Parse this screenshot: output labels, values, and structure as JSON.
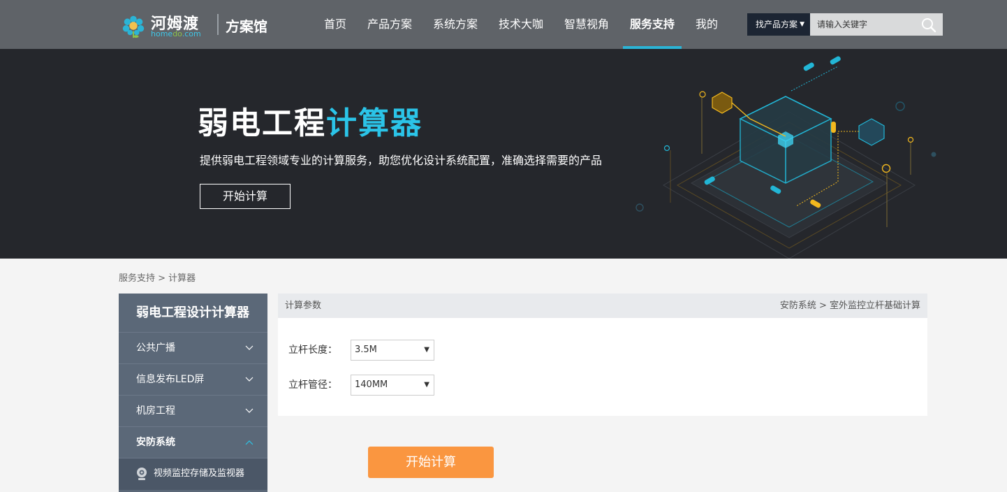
{
  "header": {
    "logo_cn": "河姆渡",
    "logo_en_a": "home",
    "logo_en_b": "do",
    "logo_en_c": ".com",
    "section_title": "方案馆",
    "nav": [
      {
        "label": "首页"
      },
      {
        "label": "产品方案"
      },
      {
        "label": "系统方案"
      },
      {
        "label": "技术大咖"
      },
      {
        "label": "智慧视角"
      },
      {
        "label": "服务支持",
        "active": true
      },
      {
        "label": "我的"
      }
    ],
    "search": {
      "category": "找产品方案",
      "placeholder": "请输入关键字"
    }
  },
  "banner": {
    "title_main": "弱电工程",
    "title_highlight": "计算器",
    "description": "提供弱电工程领域专业的计算服务，助您优化设计系统配置，准确选择需要的产品",
    "button": "开始计算"
  },
  "breadcrumb": "服务支持 > 计算器",
  "sidebar": {
    "title": "弱电工程设计计算器",
    "items": [
      {
        "label": "公共广播"
      },
      {
        "label": "信息发布LED屏"
      },
      {
        "label": "机房工程"
      },
      {
        "label": "安防系统",
        "expanded": true
      }
    ],
    "sub_items": [
      {
        "label": "视频监控存储及监视器"
      }
    ]
  },
  "panel": {
    "head_left": "计算参数",
    "head_right": "安防系统 > 室外监控立杆基础计算",
    "fields": [
      {
        "label": "立杆长度：",
        "value": "3.5M"
      },
      {
        "label": "立杆管径：",
        "value": "140MM"
      }
    ],
    "submit": "开始计算"
  },
  "colors": {
    "header_bg": "#5f6368",
    "accent": "#2bc4e8",
    "banner_bg": "#25272c",
    "sidebar_bg": "#5b6878",
    "button_orange": "#fa9640"
  }
}
